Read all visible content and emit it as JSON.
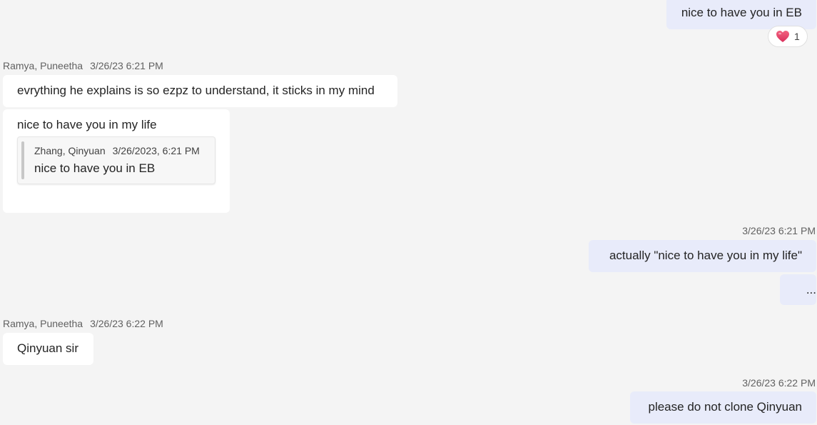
{
  "messages": {
    "m1": {
      "text": "nice to have you in EB"
    },
    "m1_reaction": {
      "icon": "heart-icon",
      "count": "1",
      "color": "#e8446a"
    },
    "group1": {
      "sender": "Ramya, Puneetha",
      "time": "3/26/23 6:21 PM"
    },
    "m2": {
      "text": "evrything he explains is so ezpz to understand, it sticks in my mind"
    },
    "m3": {
      "text": "nice to have you in my life",
      "quote": {
        "author": "Zhang, Qinyuan",
        "time": "3/26/2023, 6:21 PM",
        "text": "nice to have you in EB"
      }
    },
    "out_time1": "3/26/23 6:21 PM",
    "m4": {
      "text": "actually \"nice to have you in my life\""
    },
    "m5": {
      "text": "..."
    },
    "group2": {
      "sender": "Ramya, Puneetha",
      "time": "3/26/23 6:22 PM"
    },
    "m6": {
      "text": "Qinyuan sir"
    },
    "out_time2": "3/26/23 6:22 PM",
    "m7": {
      "text": "please do not clone Qinyuan"
    }
  },
  "colors": {
    "background": "#f4f4f4",
    "incoming_bubble": "#ffffff",
    "outgoing_bubble": "#e8ebfa"
  }
}
